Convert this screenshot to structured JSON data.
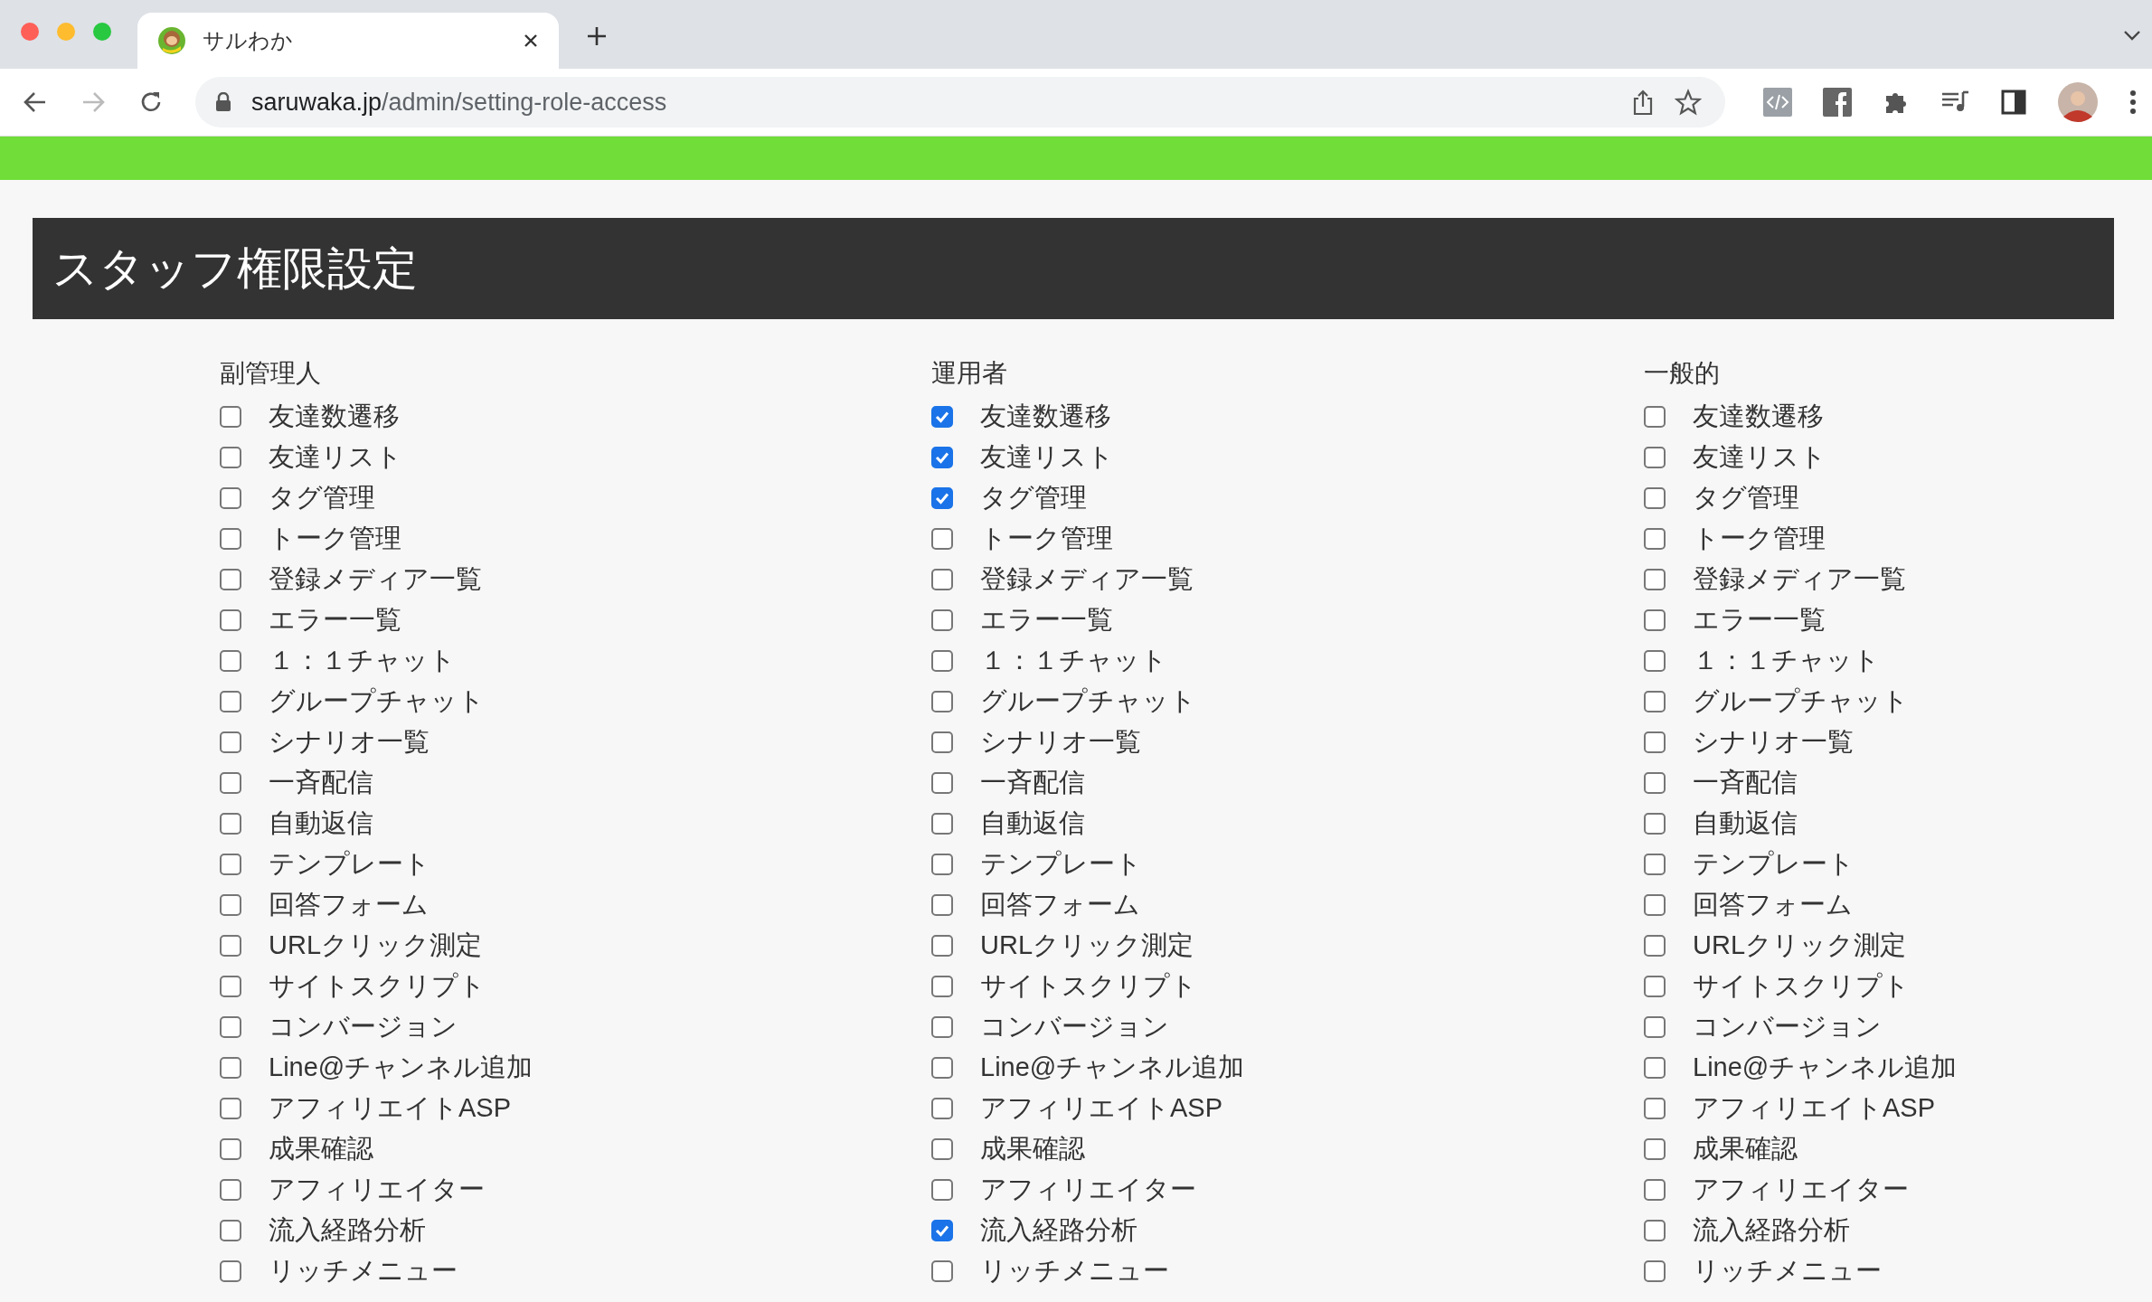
{
  "browser": {
    "tab_title": "サルわか",
    "url_host": "saruwaka.jp",
    "url_path": "/admin/setting-role-access"
  },
  "page_title": "スタッフ権限設定",
  "roles": [
    {
      "title": "副管理人",
      "items": [
        {
          "label": "友達数遷移",
          "checked": false
        },
        {
          "label": "友達リスト",
          "checked": false
        },
        {
          "label": "タグ管理",
          "checked": false
        },
        {
          "label": "トーク管理",
          "checked": false
        },
        {
          "label": "登録メディア一覧",
          "checked": false
        },
        {
          "label": "エラー一覧",
          "checked": false
        },
        {
          "label": "１：１チャット",
          "checked": false
        },
        {
          "label": "グループチャット",
          "checked": false
        },
        {
          "label": "シナリオ一覧",
          "checked": false
        },
        {
          "label": "一斉配信",
          "checked": false
        },
        {
          "label": "自動返信",
          "checked": false
        },
        {
          "label": "テンプレート",
          "checked": false
        },
        {
          "label": "回答フォーム",
          "checked": false
        },
        {
          "label": "URLクリック測定",
          "checked": false
        },
        {
          "label": "サイトスクリプト",
          "checked": false
        },
        {
          "label": "コンバージョン",
          "checked": false
        },
        {
          "label": "Line@チャンネル追加",
          "checked": false
        },
        {
          "label": "アフィリエイトASP",
          "checked": false
        },
        {
          "label": "成果確認",
          "checked": false
        },
        {
          "label": "アフィリエイター",
          "checked": false
        },
        {
          "label": "流入経路分析",
          "checked": false
        },
        {
          "label": "リッチメニュー",
          "checked": false
        }
      ]
    },
    {
      "title": "運用者",
      "items": [
        {
          "label": "友達数遷移",
          "checked": true
        },
        {
          "label": "友達リスト",
          "checked": true
        },
        {
          "label": "タグ管理",
          "checked": true
        },
        {
          "label": "トーク管理",
          "checked": false
        },
        {
          "label": "登録メディア一覧",
          "checked": false
        },
        {
          "label": "エラー一覧",
          "checked": false
        },
        {
          "label": "１：１チャット",
          "checked": false
        },
        {
          "label": "グループチャット",
          "checked": false
        },
        {
          "label": "シナリオ一覧",
          "checked": false
        },
        {
          "label": "一斉配信",
          "checked": false
        },
        {
          "label": "自動返信",
          "checked": false
        },
        {
          "label": "テンプレート",
          "checked": false
        },
        {
          "label": "回答フォーム",
          "checked": false
        },
        {
          "label": "URLクリック測定",
          "checked": false
        },
        {
          "label": "サイトスクリプト",
          "checked": false
        },
        {
          "label": "コンバージョン",
          "checked": false
        },
        {
          "label": "Line@チャンネル追加",
          "checked": false
        },
        {
          "label": "アフィリエイトASP",
          "checked": false
        },
        {
          "label": "成果確認",
          "checked": false
        },
        {
          "label": "アフィリエイター",
          "checked": false
        },
        {
          "label": "流入経路分析",
          "checked": true
        },
        {
          "label": "リッチメニュー",
          "checked": false
        }
      ]
    },
    {
      "title": "一般的",
      "items": [
        {
          "label": "友達数遷移",
          "checked": false
        },
        {
          "label": "友達リスト",
          "checked": false
        },
        {
          "label": "タグ管理",
          "checked": false
        },
        {
          "label": "トーク管理",
          "checked": false
        },
        {
          "label": "登録メディア一覧",
          "checked": false
        },
        {
          "label": "エラー一覧",
          "checked": false
        },
        {
          "label": "１：１チャット",
          "checked": false
        },
        {
          "label": "グループチャット",
          "checked": false
        },
        {
          "label": "シナリオ一覧",
          "checked": false
        },
        {
          "label": "一斉配信",
          "checked": false
        },
        {
          "label": "自動返信",
          "checked": false
        },
        {
          "label": "テンプレート",
          "checked": false
        },
        {
          "label": "回答フォーム",
          "checked": false
        },
        {
          "label": "URLクリック測定",
          "checked": false
        },
        {
          "label": "サイトスクリプト",
          "checked": false
        },
        {
          "label": "コンバージョン",
          "checked": false
        },
        {
          "label": "Line@チャンネル追加",
          "checked": false
        },
        {
          "label": "アフィリエイトASP",
          "checked": false
        },
        {
          "label": "成果確認",
          "checked": false
        },
        {
          "label": "アフィリエイター",
          "checked": false
        },
        {
          "label": "流入経路分析",
          "checked": false
        },
        {
          "label": "リッチメニュー",
          "checked": false
        }
      ]
    }
  ]
}
